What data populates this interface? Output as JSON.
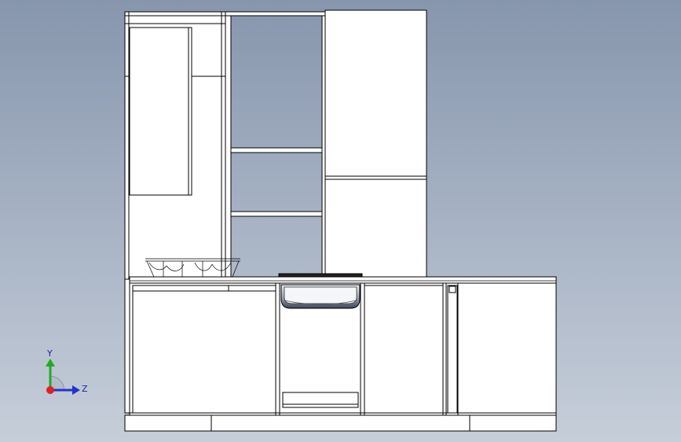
{
  "viewport": {
    "background_top": "#8796ad",
    "background_bottom": "#c6ced9"
  },
  "triad": {
    "y_label": "Y",
    "z_label": "Z",
    "y_color": "#22aa22",
    "z_color": "#2233cc",
    "x_color": "#dd2222"
  }
}
